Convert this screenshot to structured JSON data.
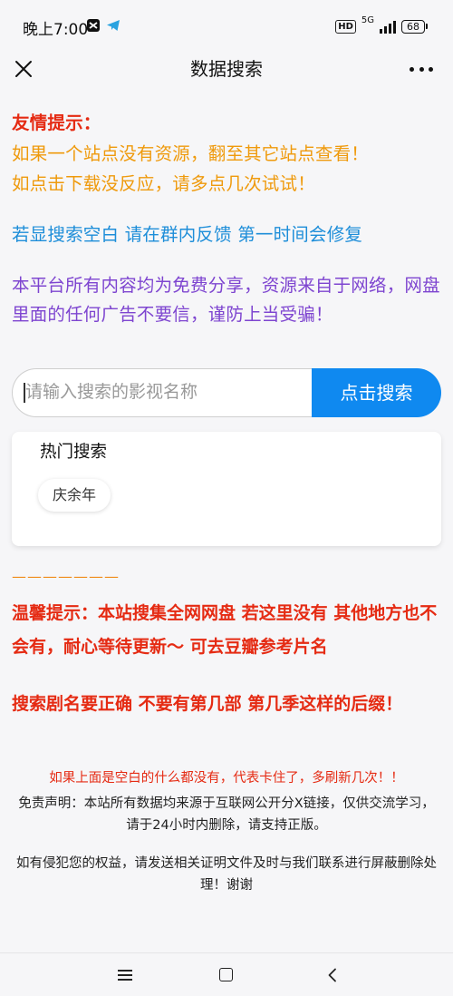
{
  "status_bar": {
    "time": "晚上7:00",
    "hd": "HD",
    "network": "5G",
    "battery": "68"
  },
  "nav": {
    "title": "数据搜索"
  },
  "notices": {
    "title": "友情提示：",
    "line1": "如果一个站点没有资源，翻至其它站点查看！",
    "line2": "如点击下载没反应，请多点几次试试！",
    "blue": "若显搜索空白 请在群内反馈 第一时间会修复",
    "purple": "本平台所有内容均为免费分享，资源来自于网络，网盘里面的任何广告不要信，谨防上当受骗！"
  },
  "search": {
    "placeholder": "请输入搜索的影视名称",
    "button_label": "点击搜索"
  },
  "hot_search": {
    "title": "热门搜索",
    "tags": [
      "庆余年"
    ]
  },
  "divider_text": "———————",
  "warm_tips": {
    "line1": "温馨提示：本站搜集全网网盘 若这里没有 其他地方也不会有，耐心等待更新～ 可去豆瓣参考片名",
    "line2": "搜索剧名要正确 不要有第几部 第几季这样的后缀！"
  },
  "footer": {
    "red": "如果上面是空白的什么都没有，代表卡住了，多刷新几次！！",
    "disclaimer": "免责声明：本站所有数据均来源于互联网公开分X链接，仅供交流学习，请于24小时内删除，请支持正版。",
    "infringement": "如有侵犯您的权益，请发送相关证明文件及时与我们联系进行屏蔽删除处理！谢谢"
  },
  "colors": {
    "red": "#e52b13",
    "orange": "#ef9a0c",
    "blue": "#1e8ed9",
    "purple": "#7e45d0",
    "button": "#0f89f0"
  },
  "icons": {
    "close": "close-icon",
    "more": "more-icon",
    "capcut": "capcut-icon",
    "telegram": "telegram-icon",
    "menu": "menu-icon",
    "home": "home-icon",
    "back": "back-icon"
  }
}
